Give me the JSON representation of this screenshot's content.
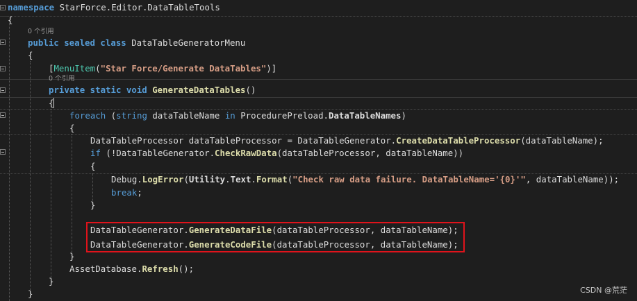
{
  "code": {
    "l1_kw": "namespace",
    "l1_name": " StarForce.Editor.DataTableTools",
    "l2_brace": "{",
    "refs_class": "0 个引用",
    "l3_kw": "public sealed class",
    "l3_name": " DataTableGeneratorMenu",
    "l4_brace": "{",
    "l5_open": "[",
    "l5_type": "MenuItem",
    "l5_paren": "(",
    "l5_str": "\"Star Force/Generate DataTables\"",
    "l5_close": ")]",
    "refs_method": "0 个引用",
    "l6_kw": "private static void",
    "l6_name": " GenerateDataTables",
    "l6_paren": "()",
    "l7_brace": "{",
    "l8_kw": "foreach",
    "l8_a": " (",
    "l8_kw2": "string",
    "l8_b": " dataTableName ",
    "l8_in": "in",
    "l8_c": " ProcedurePreload.",
    "l8_prop": "DataTableNames",
    "l8_d": ")",
    "l9_brace": "{",
    "l10_a": "DataTableProcessor dataTableProcessor = DataTableGenerator.",
    "l10_m": "CreateDataTableProcessor",
    "l10_b": "(dataTableName);",
    "l11_kw": "if",
    "l11_a": " (!DataTableGenerator.",
    "l11_m": "CheckRawData",
    "l11_b": "(dataTableProcessor, dataTableName))",
    "l12_brace": "{",
    "l13_a": "Debug.",
    "l13_m": "LogError",
    "l13_b": "(",
    "l13_p1": "Utility",
    "l13_dot1": ".",
    "l13_p2": "Text",
    "l13_dot2": ".",
    "l13_m2": "Format",
    "l13_c": "(",
    "l13_str": "\"Check raw data failure. DataTableName='{0}'\"",
    "l13_d": ", dataTableName));",
    "l14_kw": "break",
    "l14_semi": ";",
    "l15_brace": "}",
    "l16_a": "DataTableGenerator.",
    "l16_m": "GenerateDataFile",
    "l16_b": "(dataTableProcessor, dataTableName);",
    "l17_a": "DataTableGenerator.",
    "l17_m": "GenerateCodeFile",
    "l17_b": "(dataTableProcessor, dataTableName);",
    "l18_brace": "}",
    "l19_a": "AssetDatabase.",
    "l19_m": "Refresh",
    "l19_b": "();",
    "l20_brace": "}",
    "l21_brace": "}"
  },
  "watermark": "CSDN @荒茫",
  "colors": {
    "background": "#1e1e1e",
    "keyword": "#569cd6",
    "type": "#4ec9b0",
    "string": "#d69d85",
    "method": "#dcdcaa",
    "text": "#dcdcdc",
    "highlight_box": "#e0131b"
  }
}
